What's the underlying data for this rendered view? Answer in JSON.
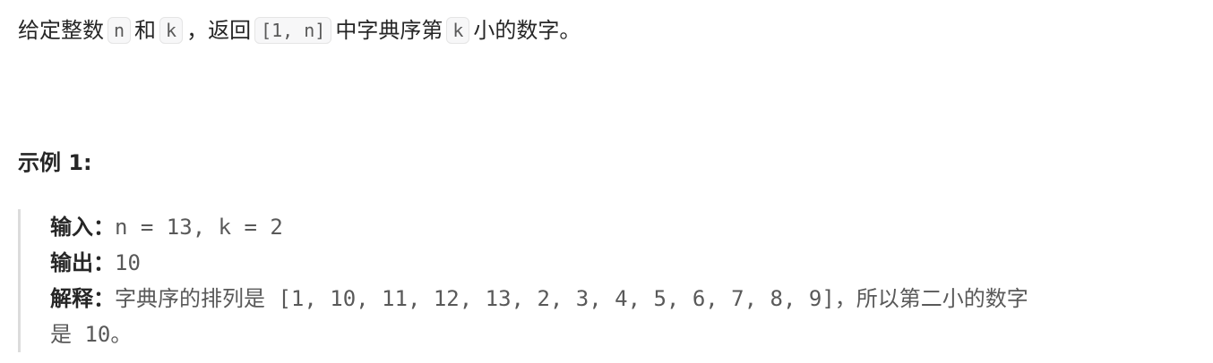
{
  "description": {
    "text_1": "给定整数",
    "var_n": "n",
    "text_2": "和",
    "var_k": "k",
    "text_3": "，返回",
    "range": "[1, n]",
    "text_4": "中字典序第",
    "var_k2": "k",
    "text_5": "小的数字。"
  },
  "example": {
    "title": "示例 1:",
    "input_label": "输入：",
    "input_value": "n = 13, k = 2",
    "output_label": "输出：",
    "output_value": "10",
    "explanation_label": "解释：",
    "explanation_text_1": "字典序的排列是",
    "explanation_list": "[1, 10, 11, 12, 13, 2, 3, 4, 5, 6, 7, 8, 9]",
    "explanation_text_2": "，所以第二小的数字",
    "explanation_text_3": "是",
    "explanation_answer": "10",
    "explanation_text_4": "。"
  }
}
